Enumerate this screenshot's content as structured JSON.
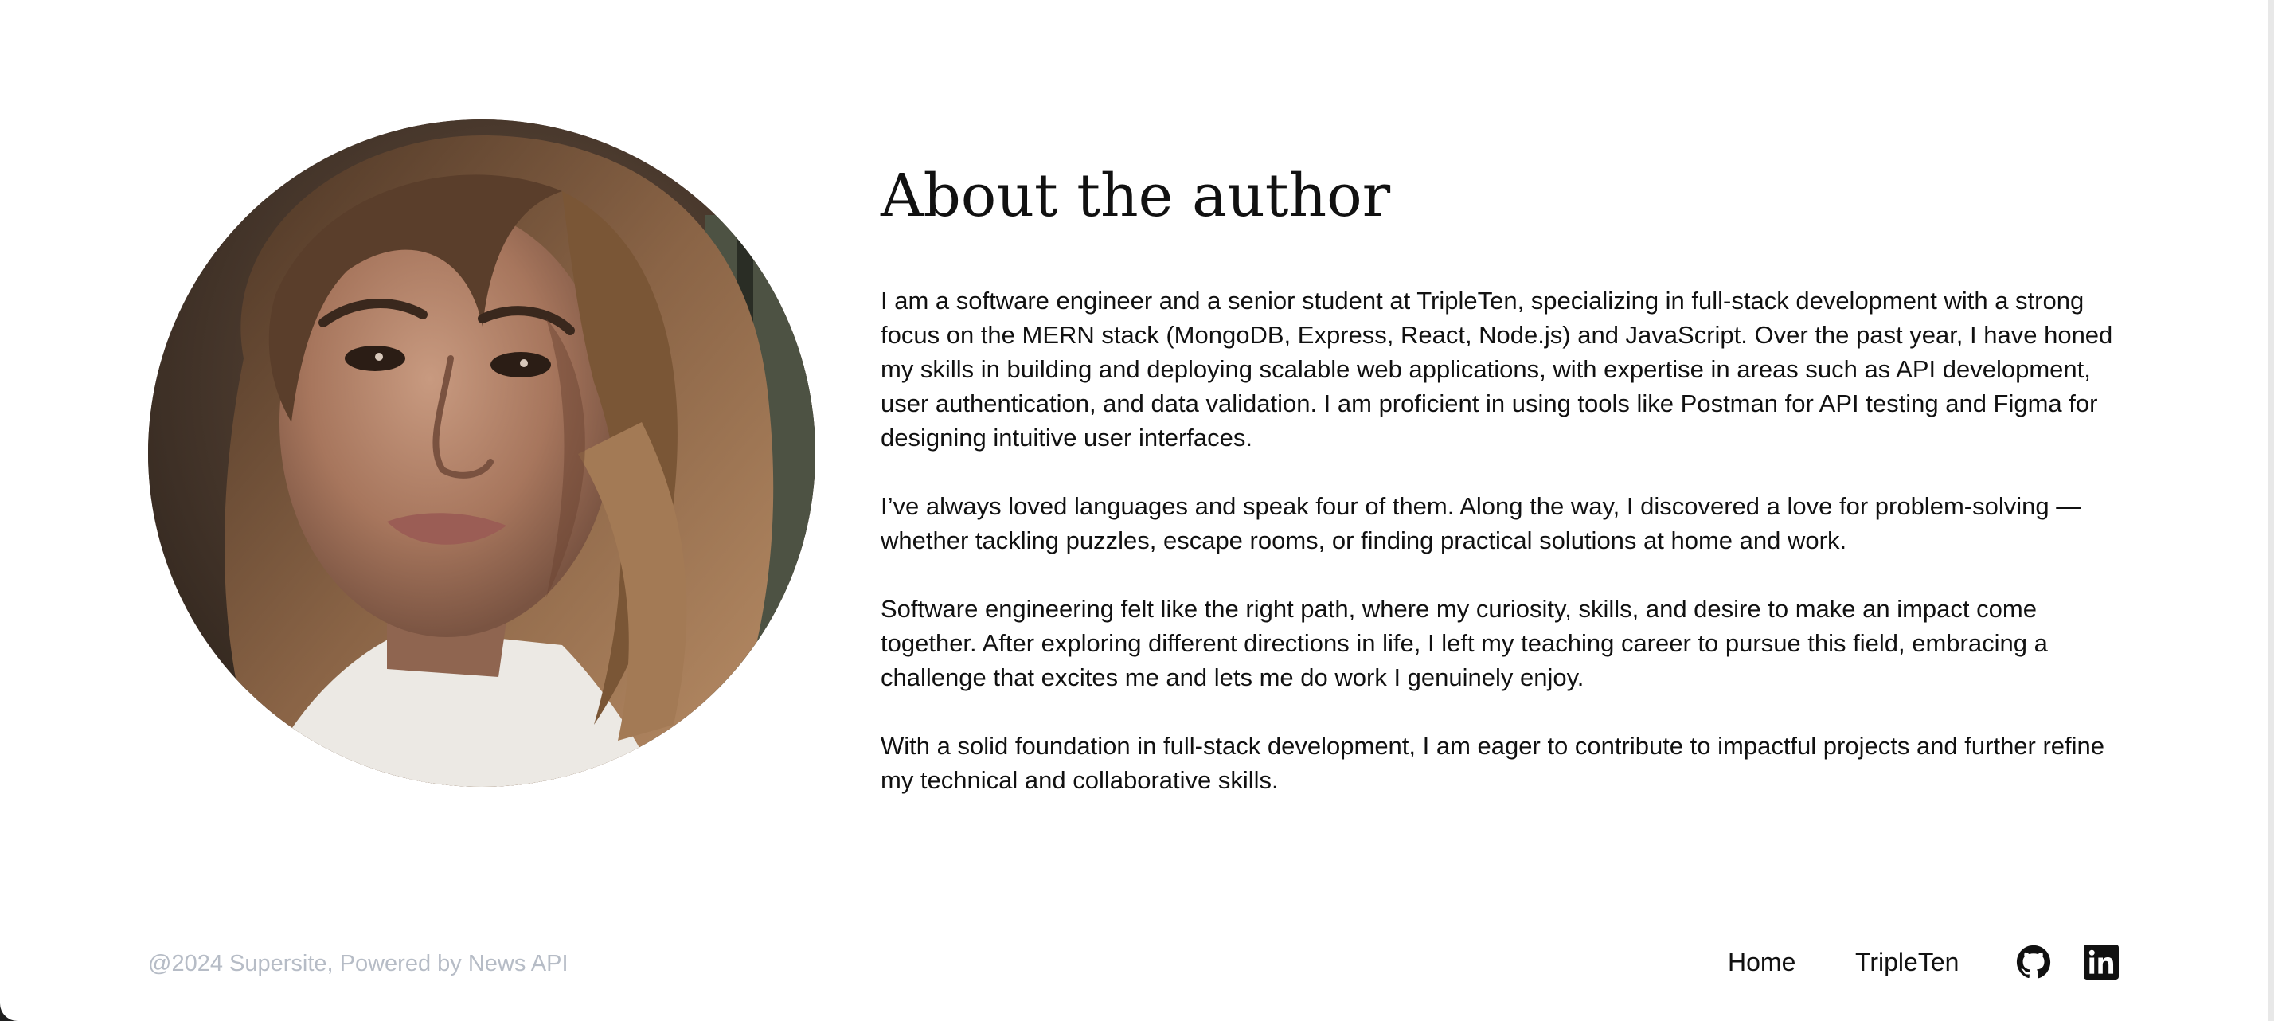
{
  "about": {
    "title": "About the author",
    "paragraphs": [
      "I am a software engineer and a senior student at TripleTen, specializing in full-stack development with a strong focus on the MERN stack (MongoDB, Express, React, Node.js) and JavaScript. Over the past year, I have honed my skills in building and deploying scalable web applications, with expertise in areas such as API development, user authentication, and data validation. I am proficient in using tools like Postman for API testing and Figma for designing intuitive user interfaces.",
      "I’ve always loved languages and speak four of them. Along the way, I discovered a love for problem-solving — whether tackling puzzles, escape rooms, or finding practical solutions at home and work.",
      "Software engineering felt like the right path, where my curiosity, skills, and desire to make an impact come together. After exploring different directions in life, I left my teaching career to pursue this field, embracing a challenge that excites me and lets me do work I genuinely enjoy.",
      "With a solid foundation in full-stack development, I am eager to contribute to impactful projects and further refine my technical and collaborative skills."
    ]
  },
  "footer": {
    "copyright": "@2024 Supersite, Powered by News API",
    "links": [
      {
        "label": "Home"
      },
      {
        "label": "TripleTen"
      }
    ],
    "icons": [
      "github-icon",
      "linkedin-icon"
    ]
  },
  "colors": {
    "text": "#111111",
    "muted": "#b6bcc6",
    "background": "#ffffff"
  }
}
